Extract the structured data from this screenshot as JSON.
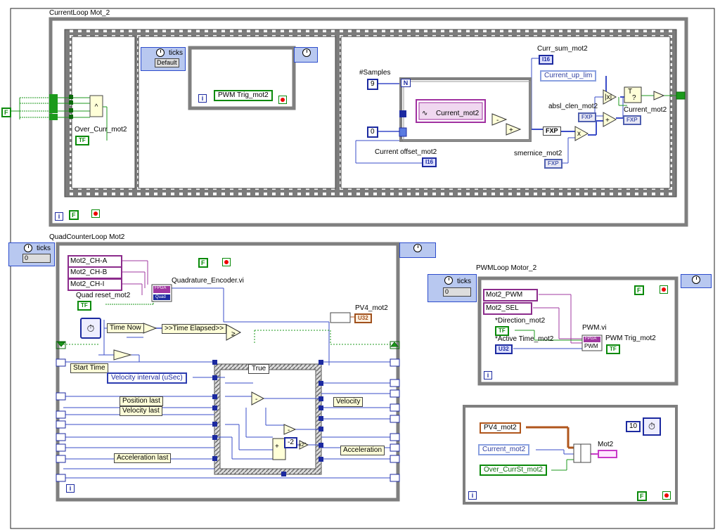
{
  "loops": {
    "current": {
      "title": "CurrentLoop Mot_2",
      "over_curr": "Over_Curr_mot2",
      "tf": "TF",
      "f_const": "F",
      "ticks": "ticks",
      "ticks_default": "Default",
      "pwm_trig_local": "PWM Trig_mot2",
      "iter_glyph": "i",
      "samples_label": "#Samples",
      "samples_value": "9",
      "n_glyph": "N",
      "current_local": "Current_mot2",
      "zero_const": "0",
      "current_offset": "Current offset_mot2",
      "i16": "I16",
      "curr_sum": "Curr_sum_mot2",
      "current_up_lim": "Current_up_lim",
      "absl_clen": "absl_clen_mot2",
      "current_out": "Current_mot2",
      "smernice": "smernice_mot2",
      "fxp": "FXP"
    },
    "quad": {
      "title": "QuadCounterLoop Mot2",
      "ticks": "ticks",
      "ticks_value": "0",
      "ch_a": "Mot2_CH-A",
      "ch_b": "Mot2_CH-B",
      "ch_i": "Mot2_CH-I",
      "encoder_vi": "Quadrature_Encoder.vi",
      "fpga": "FPGA",
      "quad": "Quad",
      "quad_reset": "Quad reset_mot2",
      "tf": "TF",
      "f_const": "F",
      "pv4": "PV4_mot2",
      "u32": "U32",
      "time_now": "Time Now",
      "time_elapsed": ">>Time Elapsed>>",
      "start_time": "Start Time",
      "velocity_interval": "Velocity interval (uSec)",
      "case_true": "True",
      "position_last": "Position last",
      "velocity_last": "Velocity last",
      "velocity": "Velocity",
      "acceleration": "Acceleration",
      "acceleration_last": "Acceleration last",
      "minus2": "-2",
      "x2": "x2^",
      "iter_glyph": "i"
    },
    "pwm": {
      "title": "PWMLoop Motor_2",
      "ticks": "ticks",
      "ticks_value": "0",
      "pwm": "Mot2_PWM",
      "sel": "Mot2_SEL",
      "direction": "*Direction_mot2",
      "active_time": "*Active Time_mot2",
      "tf": "TF",
      "u32": "U32",
      "pwm_vi": "PWM.vi",
      "fpga": "FPGA",
      "pwm_label": "PWM",
      "pwm_trig": "PWM Trig_mot2",
      "f_const": "F",
      "iter_glyph": "i"
    },
    "export": {
      "pv4": "PV4_mot2",
      "current": "Current_mot2",
      "over_currst": "Over_CurrSt_mot2",
      "mot2": "Mot2",
      "ten": "10",
      "f_const": "F",
      "iter_glyph": "i"
    }
  },
  "colors": {
    "frame": "#7f7f7f",
    "fxp_wire": "#3a4cc8",
    "bool_wire": "#1c9a1c",
    "io_wire": "#a038a0",
    "cluster_wire": "#b0561c"
  }
}
